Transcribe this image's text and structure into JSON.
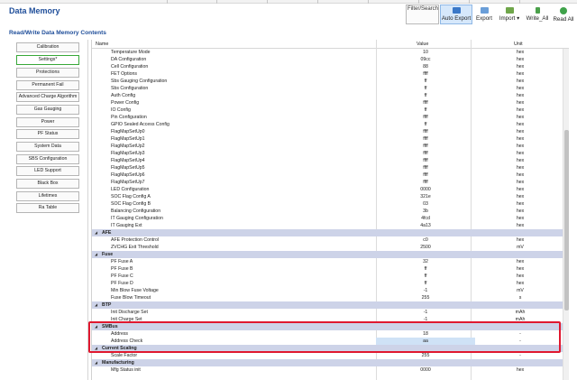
{
  "header": {
    "title": "Data Memory",
    "filter_label": "Filter/Search",
    "toolbar": [
      {
        "label": "Auto Export",
        "icon": "auto-export-icon",
        "active": true
      },
      {
        "label": "Export",
        "icon": "export-icon",
        "active": false
      },
      {
        "label": "Import",
        "icon": "import-icon",
        "active": false
      },
      {
        "label": "Write_All",
        "icon": "write-all-icon",
        "active": false
      },
      {
        "label": "Read All",
        "icon": "read-all-icon",
        "active": false
      }
    ]
  },
  "section_title": "Read/Write Data Memory Contents",
  "sidebar": {
    "items": [
      {
        "label": "Calibration",
        "selected": false
      },
      {
        "label": "Settings*",
        "selected": true
      },
      {
        "label": "Protections",
        "selected": false
      },
      {
        "label": "Permanent Fail",
        "selected": false
      },
      {
        "label": "Advanced Charge Algorithm",
        "selected": false
      },
      {
        "label": "Gas Gauging",
        "selected": false
      },
      {
        "label": "Power",
        "selected": false
      },
      {
        "label": "PF Status",
        "selected": false
      },
      {
        "label": "System Data",
        "selected": false
      },
      {
        "label": "SBS Configuration",
        "selected": false
      },
      {
        "label": "LED Support",
        "selected": false
      },
      {
        "label": "Black Box",
        "selected": false
      },
      {
        "label": "Lifetimes",
        "selected": false
      },
      {
        "label": "Ra Table",
        "selected": false
      }
    ]
  },
  "grid": {
    "columns": {
      "name": "Name",
      "value": "Value",
      "unit": "Unit"
    },
    "rows": [
      {
        "type": "item",
        "name": "Temperature Mode",
        "value": "10",
        "unit": "hex"
      },
      {
        "type": "item",
        "name": "DA Configuration",
        "value": "09cc",
        "unit": "hex"
      },
      {
        "type": "item",
        "name": "Cell Configuration",
        "value": "88",
        "unit": "hex"
      },
      {
        "type": "item",
        "name": "FET Options",
        "value": "ffff",
        "unit": "hex"
      },
      {
        "type": "item",
        "name": "Sbs Gauging Configuration",
        "value": "ff",
        "unit": "hex"
      },
      {
        "type": "item",
        "name": "Sbs Configuration",
        "value": "ff",
        "unit": "hex"
      },
      {
        "type": "item",
        "name": "Auth Config",
        "value": "ff",
        "unit": "hex"
      },
      {
        "type": "item",
        "name": "Power Config",
        "value": "ffff",
        "unit": "hex"
      },
      {
        "type": "item",
        "name": "IO Config",
        "value": "ff",
        "unit": "hex"
      },
      {
        "type": "item",
        "name": "Pin Configuration",
        "value": "ffff",
        "unit": "hex"
      },
      {
        "type": "item",
        "name": "GPIO Sealed Access Config",
        "value": "ff",
        "unit": "hex"
      },
      {
        "type": "item",
        "name": "FlagMapSetUp0",
        "value": "ffff",
        "unit": "hex"
      },
      {
        "type": "item",
        "name": "FlagMapSetUp1",
        "value": "ffff",
        "unit": "hex"
      },
      {
        "type": "item",
        "name": "FlagMapSetUp2",
        "value": "ffff",
        "unit": "hex"
      },
      {
        "type": "item",
        "name": "FlagMapSetUp3",
        "value": "ffff",
        "unit": "hex"
      },
      {
        "type": "item",
        "name": "FlagMapSetUp4",
        "value": "ffff",
        "unit": "hex"
      },
      {
        "type": "item",
        "name": "FlagMapSetUp5",
        "value": "ffff",
        "unit": "hex"
      },
      {
        "type": "item",
        "name": "FlagMapSetUp6",
        "value": "ffff",
        "unit": "hex"
      },
      {
        "type": "item",
        "name": "FlagMapSetUp7",
        "value": "ffff",
        "unit": "hex"
      },
      {
        "type": "item",
        "name": "LED Configuration",
        "value": "0000",
        "unit": "hex"
      },
      {
        "type": "item",
        "name": "SOC Flag Config A",
        "value": "321e",
        "unit": "hex"
      },
      {
        "type": "item",
        "name": "SOC Flag Config B",
        "value": "03",
        "unit": "hex"
      },
      {
        "type": "item",
        "name": "Balancing Configuration",
        "value": "3b",
        "unit": "hex"
      },
      {
        "type": "item",
        "name": "IT Gauging Configuration",
        "value": "4fcd",
        "unit": "hex"
      },
      {
        "type": "item",
        "name": "IT Gauging Ext",
        "value": "4a13",
        "unit": "hex"
      },
      {
        "type": "group",
        "name": "AFE"
      },
      {
        "type": "item",
        "name": "AFE Protection Control",
        "value": "c0",
        "unit": "hex"
      },
      {
        "type": "item",
        "name": "ZVCHG Exit Threshold",
        "value": "2500",
        "unit": "mV"
      },
      {
        "type": "group",
        "name": "Fuse"
      },
      {
        "type": "item",
        "name": "PF Fuse A",
        "value": "32",
        "unit": "hex"
      },
      {
        "type": "item",
        "name": "PF Fuse B",
        "value": "ff",
        "unit": "hex"
      },
      {
        "type": "item",
        "name": "PF Fuse C",
        "value": "ff",
        "unit": "hex"
      },
      {
        "type": "item",
        "name": "PF Fuse D",
        "value": "ff",
        "unit": "hex"
      },
      {
        "type": "item",
        "name": "Min Blow Fuse Voltage",
        "value": "-1",
        "unit": "mV"
      },
      {
        "type": "item",
        "name": "Fuse Blow Timeout",
        "value": "255",
        "unit": "s"
      },
      {
        "type": "group",
        "name": "BTP"
      },
      {
        "type": "item",
        "name": "Init Discharge Set",
        "value": "-1",
        "unit": "mAh"
      },
      {
        "type": "item",
        "name": "Init Charge Set",
        "value": "-1",
        "unit": "mAh"
      },
      {
        "type": "group",
        "name": "SMBus"
      },
      {
        "type": "item",
        "name": "Address",
        "value": "18",
        "unit": "-"
      },
      {
        "type": "item",
        "name": "Address Check",
        "value": "aa",
        "unit": "-",
        "highlight": true
      },
      {
        "type": "group",
        "name": "Current Scaling"
      },
      {
        "type": "item",
        "name": "Scale Factor",
        "value": "255",
        "unit": "-"
      },
      {
        "type": "group",
        "name": "Manufacturing"
      },
      {
        "type": "item",
        "name": "Mfg Status init",
        "value": "0000",
        "unit": "hex"
      }
    ]
  },
  "colors": {
    "title_blue": "#1f4e9a",
    "group_row": "#cdd3e8",
    "selected_border": "#38a838",
    "callout_red": "#e0182f",
    "active_button": "#d6e8fb"
  }
}
